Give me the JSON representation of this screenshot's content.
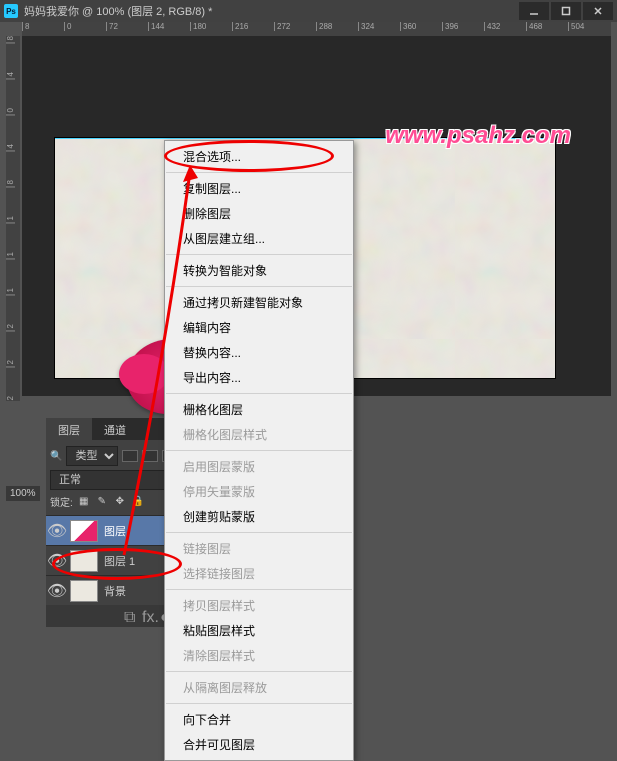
{
  "title": "妈妈我爱你 @ 100% (图层 2, RGB/8) *",
  "watermark": "www.psahz.com",
  "zoom": "100%",
  "ruler_h": [
    "8",
    "0",
    "72",
    "144",
    "180",
    "216",
    "272",
    "288",
    "324",
    "360",
    "396",
    "432",
    "468",
    "504"
  ],
  "ruler_v": [
    "8",
    "4",
    "0",
    "4",
    "8",
    "1",
    "1",
    "1",
    "2",
    "2",
    "2"
  ],
  "panels": {
    "tabs": [
      "图层",
      "通道"
    ],
    "kind_label": "类型",
    "blend_mode": "正常",
    "lock_label": "锁定:"
  },
  "layers": [
    {
      "name": "图层",
      "selected": true,
      "thumb": "flower"
    },
    {
      "name": "图层 1",
      "selected": false,
      "thumb": "bg"
    },
    {
      "name": "背景",
      "selected": false,
      "thumb": "bg"
    }
  ],
  "footer_label": "fx.",
  "context_menu": [
    {
      "label": "混合选项...",
      "enabled": true
    },
    {
      "sep": true
    },
    {
      "label": "复制图层...",
      "enabled": true
    },
    {
      "label": "删除图层",
      "enabled": true
    },
    {
      "label": "从图层建立组...",
      "enabled": true
    },
    {
      "sep": true
    },
    {
      "label": "转换为智能对象",
      "enabled": true
    },
    {
      "sep": true
    },
    {
      "label": "通过拷贝新建智能对象",
      "enabled": true
    },
    {
      "label": "编辑内容",
      "enabled": true
    },
    {
      "label": "替换内容...",
      "enabled": true
    },
    {
      "label": "导出内容...",
      "enabled": true
    },
    {
      "sep": true
    },
    {
      "label": "栅格化图层",
      "enabled": true
    },
    {
      "label": "栅格化图层样式",
      "enabled": false
    },
    {
      "sep": true
    },
    {
      "label": "启用图层蒙版",
      "enabled": false
    },
    {
      "label": "停用矢量蒙版",
      "enabled": false
    },
    {
      "label": "创建剪贴蒙版",
      "enabled": true
    },
    {
      "sep": true
    },
    {
      "label": "链接图层",
      "enabled": false
    },
    {
      "label": "选择链接图层",
      "enabled": false
    },
    {
      "sep": true
    },
    {
      "label": "拷贝图层样式",
      "enabled": false
    },
    {
      "label": "粘贴图层样式",
      "enabled": true
    },
    {
      "label": "清除图层样式",
      "enabled": false
    },
    {
      "sep": true
    },
    {
      "label": "从隔离图层释放",
      "enabled": false
    },
    {
      "sep": true
    },
    {
      "label": "向下合并",
      "enabled": true
    },
    {
      "label": "合并可见图层",
      "enabled": true
    }
  ]
}
